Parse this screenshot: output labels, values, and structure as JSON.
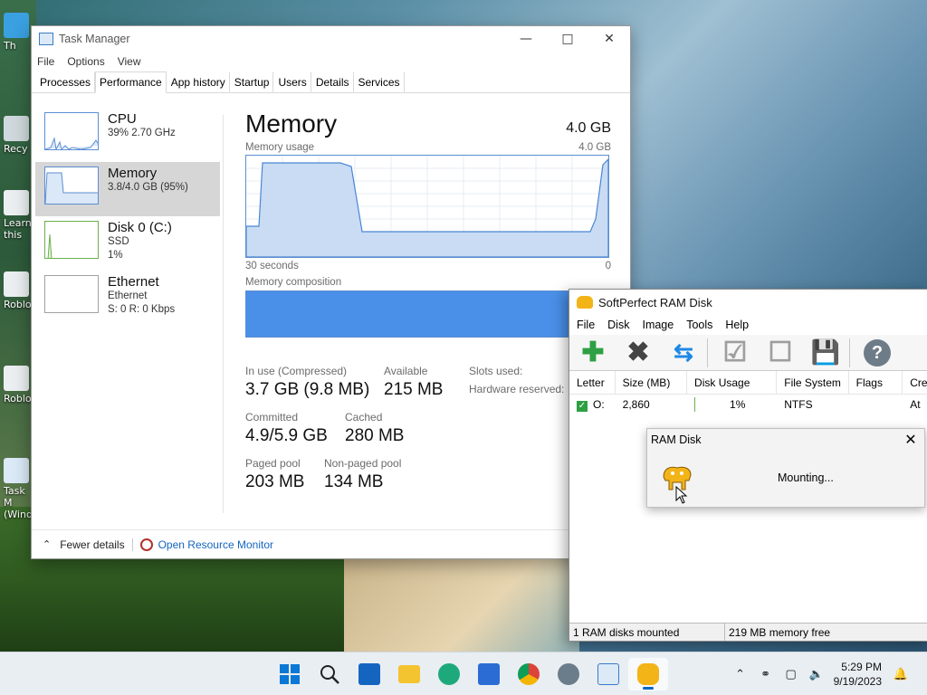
{
  "task_manager": {
    "title": "Task Manager",
    "menu": [
      "File",
      "Options",
      "View"
    ],
    "tabs": [
      "Processes",
      "Performance",
      "App history",
      "Startup",
      "Users",
      "Details",
      "Services"
    ],
    "active_tab": "Performance",
    "sidebar": [
      {
        "name": "CPU",
        "sub1": "39%  2.70 GHz",
        "sub2": ""
      },
      {
        "name": "Memory",
        "sub1": "3.8/4.0 GB (95%)",
        "sub2": ""
      },
      {
        "name": "Disk 0 (C:)",
        "sub1": "SSD",
        "sub2": "1%"
      },
      {
        "name": "Ethernet",
        "sub1": "Ethernet",
        "sub2": "S: 0  R: 0 Kbps"
      }
    ],
    "memory": {
      "title": "Memory",
      "total": "4.0 GB",
      "usage_label": "Memory usage",
      "usage_max": "4.0 GB",
      "time_left": "30 seconds",
      "time_right": "0",
      "composition_label": "Memory composition",
      "stats": {
        "in_use_label": "In use (Compressed)",
        "in_use": "3.7 GB (9.8 MB)",
        "available_label": "Available",
        "available": "215 MB",
        "slots_label": "Slots used:",
        "hw_reserved_label": "Hardware reserved:",
        "committed_label": "Committed",
        "committed": "4.9/5.9 GB",
        "cached_label": "Cached",
        "cached": "280 MB",
        "paged_label": "Paged pool",
        "paged": "203 MB",
        "nonpaged_label": "Non-paged pool",
        "nonpaged": "134 MB"
      }
    },
    "footer": {
      "fewer": "Fewer details",
      "resource_monitor": "Open Resource Monitor"
    }
  },
  "ramdisk": {
    "title": "SoftPerfect RAM Disk",
    "menu": [
      "File",
      "Disk",
      "Image",
      "Tools",
      "Help"
    ],
    "columns": [
      "Letter",
      "Size (MB)",
      "Disk Usage",
      "File System",
      "Flags",
      "Cre"
    ],
    "rows": [
      {
        "letter": "O:",
        "size": "2,860",
        "usage": "1%",
        "fs": "NTFS",
        "flags": "",
        "created": "At"
      }
    ],
    "status_left": "1 RAM disks mounted",
    "status_right": "219 MB memory free"
  },
  "dialog": {
    "title": "RAM Disk",
    "message": "Mounting..."
  },
  "desktop_icons": [
    "Th",
    "Recy",
    "Learn this",
    "Roblo",
    "Roblo",
    "Task M (Wind"
  ],
  "clock": {
    "time": "5:29 PM",
    "date": "9/19/2023"
  },
  "colors": {
    "accent": "#0067c0",
    "memory_fill": "#4a8fe8",
    "graph_line": "#5c8ed1"
  }
}
